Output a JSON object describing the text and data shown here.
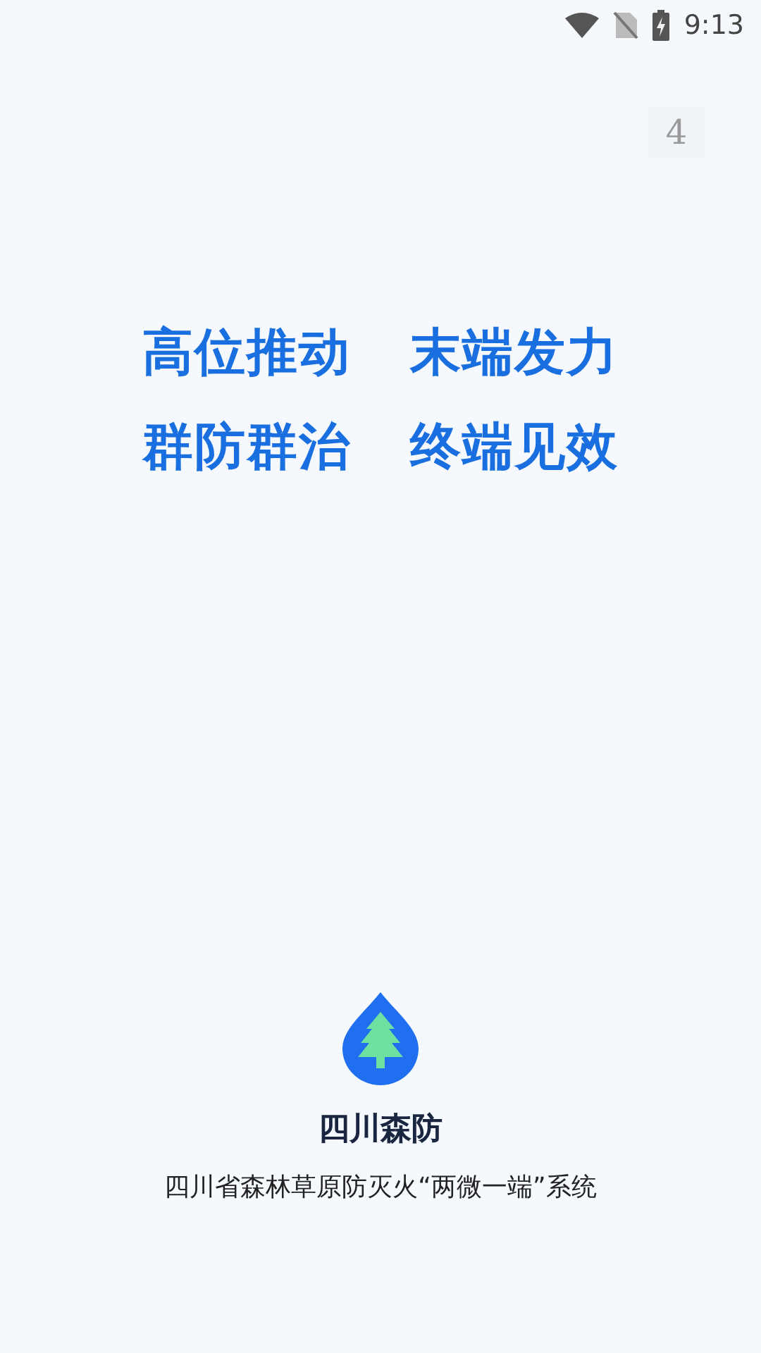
{
  "status_bar": {
    "time": "9:13"
  },
  "countdown": "4",
  "slogan": [
    [
      "高位推动",
      "末端发力"
    ],
    [
      "群防群治",
      "终端见效"
    ]
  ],
  "app_name": "四川森防",
  "subtitle": "四川省森林草原防灭火“两微一端”系统"
}
